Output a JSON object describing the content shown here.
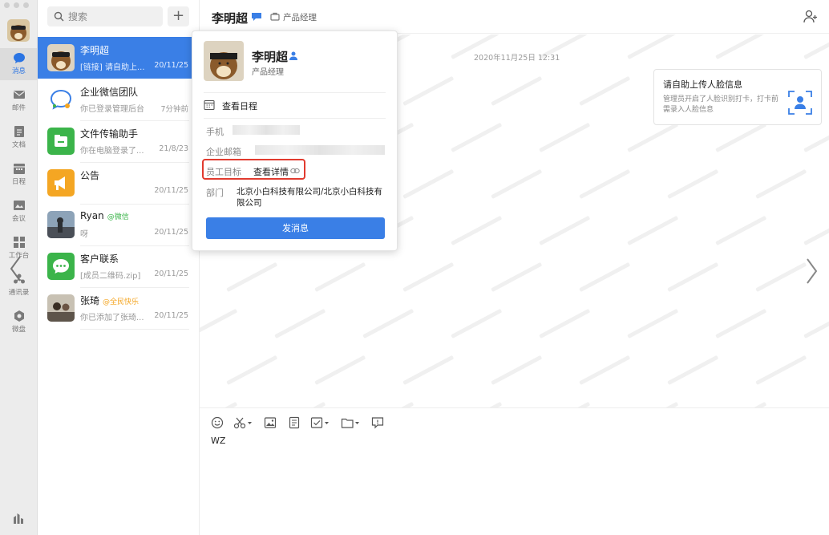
{
  "sidebar": {
    "items": [
      {
        "label": "消息",
        "icon": "chat-bubble-icon",
        "active": true
      },
      {
        "label": "邮件",
        "icon": "mail-icon"
      },
      {
        "label": "文档",
        "icon": "document-icon"
      },
      {
        "label": "日程",
        "icon": "calendar-icon"
      },
      {
        "label": "会议",
        "icon": "meeting-icon"
      },
      {
        "label": "工作台",
        "icon": "workbench-icon"
      },
      {
        "label": "通讯录",
        "icon": "contacts-icon"
      },
      {
        "label": "微盘",
        "icon": "cloud-disk-icon"
      }
    ]
  },
  "search": {
    "placeholder": "搜索"
  },
  "conversations": [
    {
      "name": "李明超",
      "tag": "",
      "preview": "[链接] 请自助上...",
      "time": "20/11/25",
      "active": true
    },
    {
      "name": "企业微信团队",
      "tag": "",
      "preview": "你已登录管理后台",
      "time": "7分钟前"
    },
    {
      "name": "文件传输助手",
      "tag": "",
      "preview": "你在电脑登录了...",
      "time": "21/8/23"
    },
    {
      "name": "公告",
      "tag": "",
      "preview": "",
      "time": "20/11/25"
    },
    {
      "name": "Ryan",
      "tag": "@微信",
      "preview": "呀",
      "time": "20/11/25"
    },
    {
      "name": "客户联系",
      "tag": "",
      "preview": "[成员二维码.zip]",
      "time": "20/11/25"
    },
    {
      "name": "张琦",
      "tag": "@全民快乐",
      "preview": "你已添加了张琦...",
      "time": "20/11/25"
    }
  ],
  "header": {
    "name": "李明超",
    "title": "产品经理"
  },
  "chat": {
    "date": "2020年11月25日 12:31",
    "card": {
      "title": "请自助上传人脸信息",
      "body": "管理员开启了人脸识别打卡，打卡前需录入人脸信息"
    }
  },
  "composer": {
    "draft": "WZ"
  },
  "profile": {
    "name": "李明超",
    "title": "产品经理",
    "schedule": "查看日程",
    "phone_label": "手机",
    "email_label": "企业邮箱",
    "goal_label": "员工目标",
    "goal_link": "查看详情",
    "dept_label": "部门",
    "dept_value": "北京小白科技有限公司/北京小白科技有限公司",
    "send_button": "发消息"
  },
  "colors": {
    "accent": "#3a7fe6",
    "highlight": "#e13b2f",
    "green": "#3bb44a",
    "orange": "#f4a623"
  }
}
